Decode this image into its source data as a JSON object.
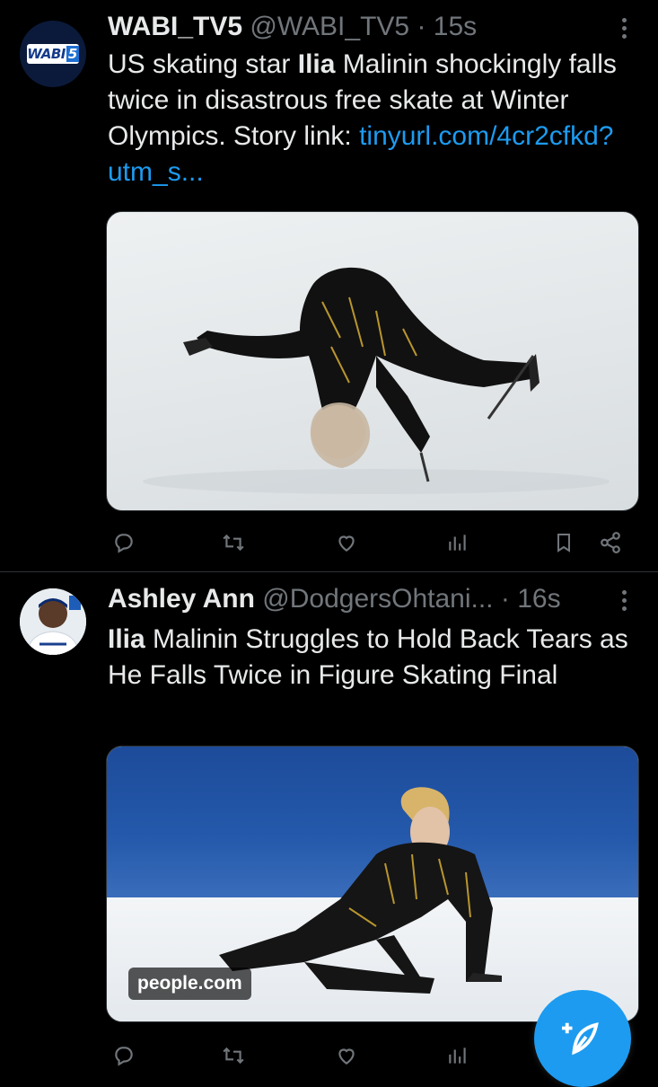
{
  "tweets": [
    {
      "name": "WABI_TV5",
      "handle": "@WABI_TV5",
      "dot": "·",
      "time": "15s",
      "text_parts": [
        "US skating star ",
        "Ilia",
        " Malinin shockingly falls twice in disastrous free skate at Winter Olympics. Story link: "
      ],
      "link": "tinyurl.com/4cr2cfkd?utm_s...",
      "avatar_logo": {
        "prefix": "WABI",
        "number": "5"
      }
    },
    {
      "name": "Ashley Ann",
      "handle": "@DodgersOhtani...",
      "dot": "·",
      "time": "16s",
      "text_parts": [
        "Ilia",
        " Malinin Struggles to Hold Back Tears as He Falls Twice in Figure Skating Final"
      ],
      "media_source": "people.com"
    }
  ],
  "actions": [
    "reply-icon",
    "retweet-icon",
    "like-icon",
    "views-icon",
    "bookmark-icon",
    "share-icon"
  ],
  "colors": {
    "background": "#000000",
    "text": "#e7e9ea",
    "secondary": "#71767b",
    "link": "#1d9bf0",
    "accent": "#1d9bf0",
    "divider": "#2f3336"
  },
  "fab": {
    "icon": "compose-post-icon"
  }
}
